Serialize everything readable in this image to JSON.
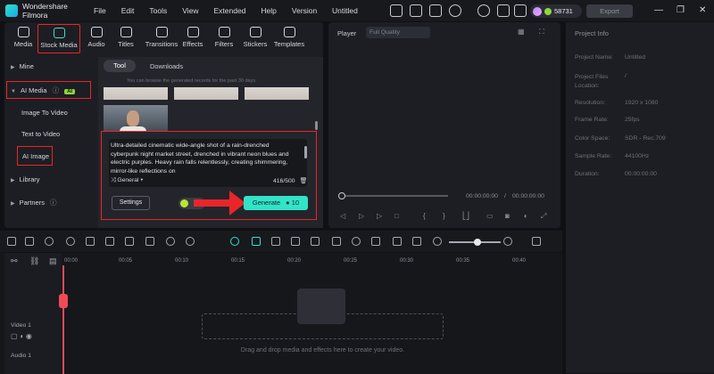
{
  "titlebar": {
    "app_name": "Wondershare Filmora",
    "menu": [
      "File",
      "Edit",
      "Tools",
      "View",
      "Extended",
      "Help",
      "Version"
    ],
    "doc_title": "Untitled",
    "credits": "58731",
    "export_label": "Export",
    "icons": [
      "gift-icon",
      "image-icon",
      "upload-icon",
      "cloud-icon",
      "headset-icon",
      "grid-icon"
    ]
  },
  "media_tabs": [
    {
      "label": "Media",
      "icon": "media-icon"
    },
    {
      "label": "Stock Media",
      "icon": "stock-media-icon"
    },
    {
      "label": "Audio",
      "icon": "audio-icon"
    },
    {
      "label": "Titles",
      "icon": "titles-icon"
    },
    {
      "label": "Transitions",
      "icon": "transitions-icon"
    },
    {
      "label": "Effects",
      "icon": "effects-icon"
    },
    {
      "label": "Filters",
      "icon": "filters-icon"
    },
    {
      "label": "Stickers",
      "icon": "stickers-icon"
    },
    {
      "label": "Templates",
      "icon": "templates-icon"
    }
  ],
  "sidebar": {
    "mine": "Mine",
    "ai_media": "AI Media",
    "ai_badge": "AI",
    "ai_items": [
      "Image To Video",
      "Text to Video",
      "AI Image"
    ],
    "library": "Library",
    "partners": "Partners"
  },
  "content": {
    "tool_tab": "Tool",
    "downloads_tab": "Downloads",
    "hint": "You can browse the generated records for the past 30 days."
  },
  "prompt": {
    "text": "Ultra-detailed cinematic wide-angle shot of a rain-drenched cyberpunk night market street, drenched in vibrant neon blues and electric purples. Heavy rain falls relentlessly, creating shimmering, mirror-like reflections on",
    "style": "General",
    "char_count": "416/500",
    "settings_label": "Settings",
    "generate_label": "Generate",
    "generate_cost": "10"
  },
  "player": {
    "label": "Player",
    "quality": "Full Quality",
    "current_time": "00:00:00:00",
    "total_time": "00:00:00:00"
  },
  "project_info": {
    "title": "Project Info",
    "rows": [
      {
        "label": "Project Name:",
        "value": "Untitled"
      },
      {
        "label": "Project Files Location:",
        "value": "/"
      },
      {
        "label": "Resolution:",
        "value": "1920 x 1080"
      },
      {
        "label": "Frame Rate:",
        "value": "25fps"
      },
      {
        "label": "Color Space:",
        "value": "SDR - Rec.709"
      },
      {
        "label": "Sample Rate:",
        "value": "44100Hz"
      },
      {
        "label": "Duration:",
        "value": "00:00:00:00"
      }
    ]
  },
  "timeline": {
    "ruler": [
      "00:00",
      "00:05",
      "00:10",
      "00:15",
      "00:20",
      "00:25",
      "00:30",
      "00:35",
      "00:40"
    ],
    "drop_hint": "Drag and drop media and effects here to create your video.",
    "video_track": "Video 1",
    "audio_track": "Audio 1",
    "zoom_level": 0.55
  },
  "colors": {
    "accent": "#33e3c8",
    "highlight_box": "#e8262a",
    "ai_badge": "#8fd63a",
    "playhead": "#ef4b56"
  }
}
